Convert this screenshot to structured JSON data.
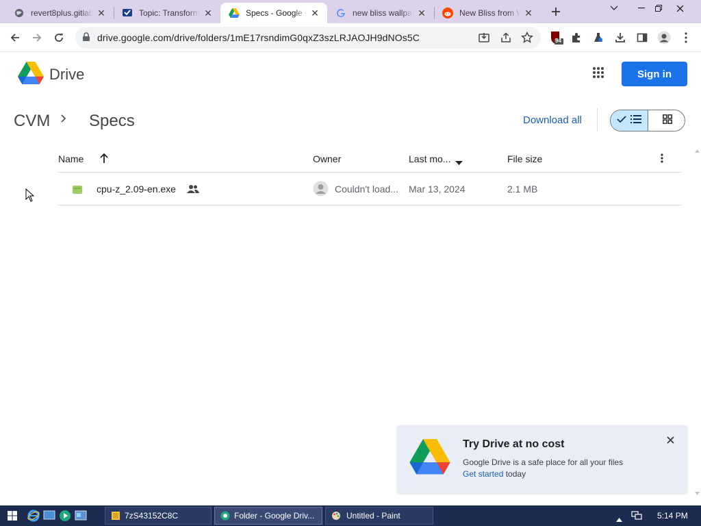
{
  "browser": {
    "tabs": [
      {
        "title": "revert8plus.gitlab",
        "icon": "globe-icon",
        "active": false
      },
      {
        "title": "Topic: Transform",
        "icon": "forum-icon",
        "active": false
      },
      {
        "title": "Specs - Google D",
        "icon": "drive-icon",
        "active": true
      },
      {
        "title": "new bliss wallpap",
        "icon": "google-icon",
        "active": false
      },
      {
        "title": "New Bliss from W",
        "icon": "reddit-icon",
        "active": false
      }
    ],
    "url": "drive.google.com/drive/folders/1mE17rsndimG0qxZ3szLRJAOJH9dNOs5C",
    "extension_badge": "94"
  },
  "drive": {
    "app_name": "Drive",
    "signin_label": "Sign in",
    "breadcrumb": {
      "parent": "CVM",
      "current": "Specs"
    },
    "download_all_label": "Download all"
  },
  "table": {
    "headers": {
      "name": "Name",
      "owner": "Owner",
      "modified": "Last mo...",
      "size": "File size"
    },
    "rows": [
      {
        "name": "cpu-z_2.09-en.exe",
        "owner": "Couldn't load...",
        "modified": "Mar 13, 2024",
        "size": "2.1 MB"
      }
    ]
  },
  "promo": {
    "title": "Try Drive at no cost",
    "body": "Google Drive is a safe place for all your files",
    "link": "Get started",
    "link_suffix": " today"
  },
  "taskbar": {
    "items": [
      "7zS43152C8C",
      "Folder - Google Driv...",
      "Untitled - Paint"
    ],
    "clock": "5:14 PM"
  },
  "colors": {
    "accent": "#1a73e8",
    "selected_toggle": "#c2e7ff",
    "taskbar": "#1d2b51"
  }
}
